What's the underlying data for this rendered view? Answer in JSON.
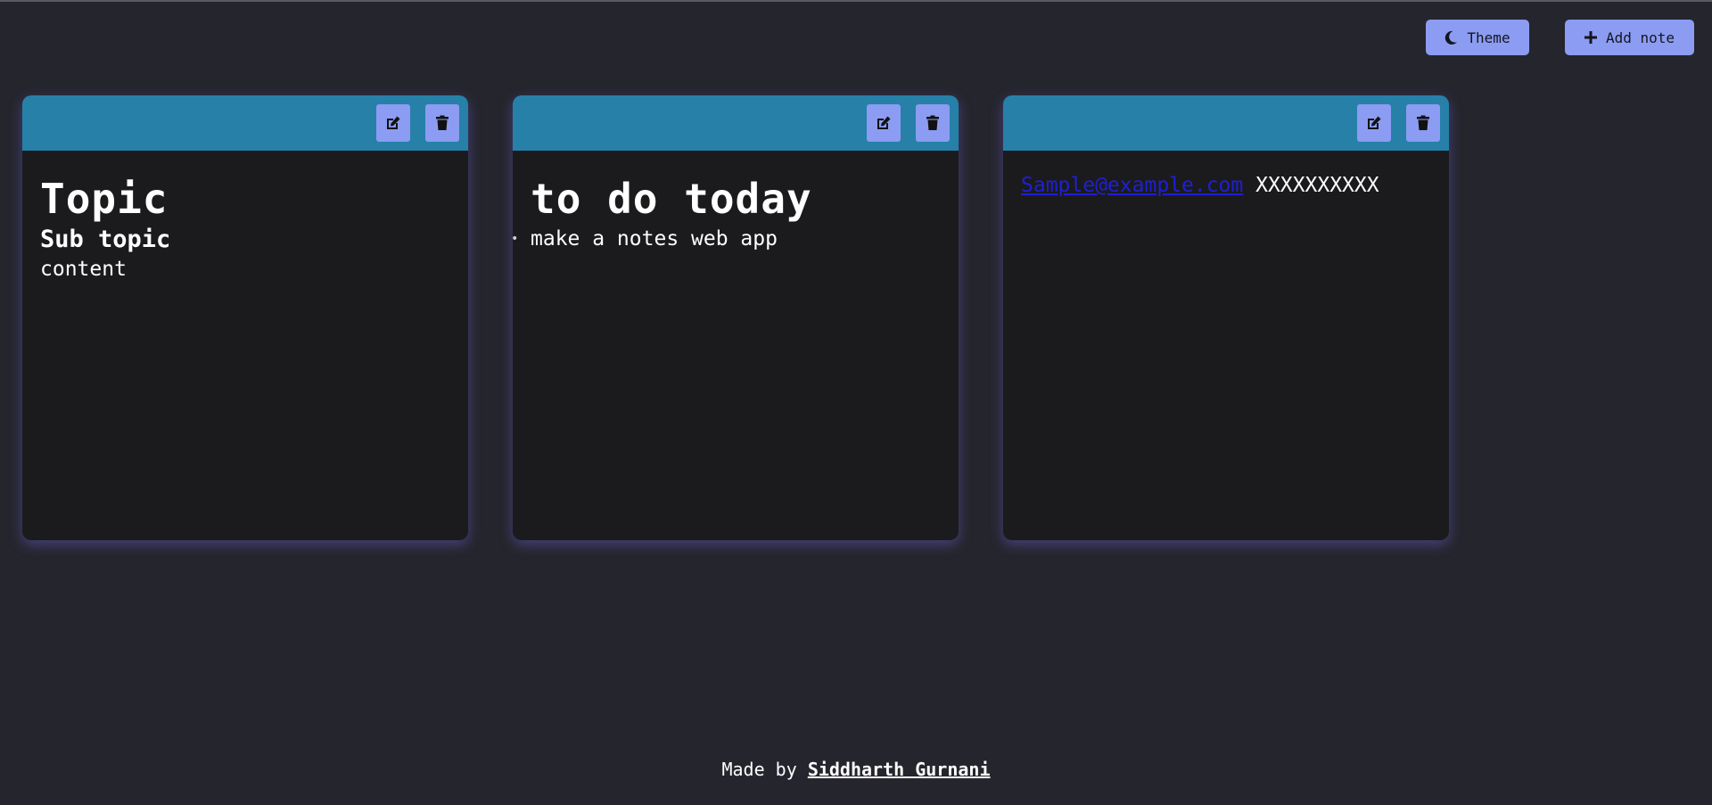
{
  "toolbar": {
    "theme_label": "Theme",
    "theme_icon": "moon-icon",
    "add_note_label": "Add note",
    "add_note_icon": "plus-icon"
  },
  "notes": [
    {
      "heading": "Topic",
      "subheading": "Sub topic",
      "content": "content",
      "edit_icon": "edit-icon",
      "delete_icon": "trash-icon"
    },
    {
      "heading": "to do today",
      "list_item": "make a notes web app",
      "edit_icon": "edit-icon",
      "delete_icon": "trash-icon"
    },
    {
      "email": "Sample@example.com",
      "phone": "XXXXXXXXXX",
      "edit_icon": "edit-icon",
      "delete_icon": "trash-icon"
    }
  ],
  "footer": {
    "prefix": "Made by",
    "author": "Siddharth Gurnani"
  },
  "colors": {
    "background": "#25252d",
    "note_header": "#2780a8",
    "note_body": "#1b1b1d",
    "button": "#8b9cf2",
    "link": "#1f1fd6"
  }
}
